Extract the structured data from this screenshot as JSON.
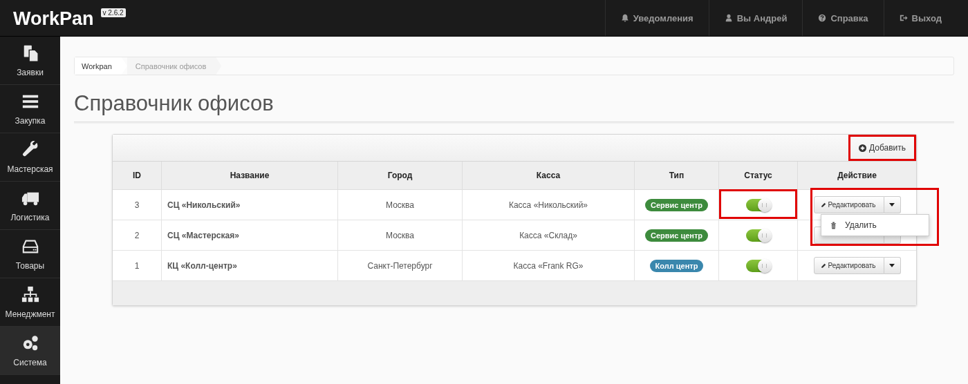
{
  "header": {
    "logo": "WorkPan",
    "version": "v 2.6.2",
    "nav": [
      {
        "label": "Уведомления"
      },
      {
        "label": "Вы Андрей"
      },
      {
        "label": "Справка"
      },
      {
        "label": "Выход"
      }
    ]
  },
  "sidebar": {
    "items": [
      {
        "label": "Заявки",
        "selected": false
      },
      {
        "label": "Закупка",
        "selected": false
      },
      {
        "label": "Мастерская",
        "selected": false
      },
      {
        "label": "Логистика",
        "selected": false
      },
      {
        "label": "Товары",
        "selected": false
      },
      {
        "label": "Менеджмент",
        "selected": false
      },
      {
        "label": "Система",
        "selected": true
      }
    ]
  },
  "breadcrumb": [
    "Workpan",
    "Справочник офисов"
  ],
  "page_title": "Справочник офисов",
  "add_button": {
    "label": "Добавить",
    "highlighted": true
  },
  "table": {
    "columns": [
      "ID",
      "Название",
      "Город",
      "Касса",
      "Тип",
      "Статус",
      "Действие"
    ],
    "rows": [
      {
        "id": "3",
        "name": "СЦ «Никольский»",
        "city": "Москва",
        "cashbox": "Касса «Никольский»",
        "type": {
          "label": "Сервис центр",
          "color": "#3d8b3d"
        },
        "on": true,
        "edit_label": "Редактировать",
        "highlighted": true,
        "menu": [
          "Удалить"
        ]
      },
      {
        "id": "2",
        "name": "СЦ «Мастерская»",
        "city": "Москва",
        "cashbox": "Касса «Склад»",
        "type": {
          "label": "Сервис центр",
          "color": "#3d8b3d"
        },
        "on": true,
        "highlighted": false
      },
      {
        "id": "1",
        "name": "КЦ «Колл-центр»",
        "city": "Санкт-Петербург",
        "cashbox": "Касса «Frank RG»",
        "type": {
          "label": "Колл центр",
          "color": "#3a87ad"
        },
        "on": true,
        "edit_label": "Редактировать",
        "highlighted": false
      }
    ]
  }
}
